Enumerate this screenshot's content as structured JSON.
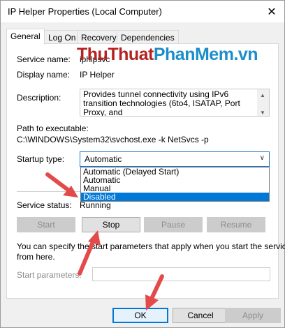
{
  "window": {
    "title": "IP Helper Properties (Local Computer)"
  },
  "icons": {
    "close": "close-icon"
  },
  "tabs": [
    {
      "label": "General"
    },
    {
      "label": "Log On"
    },
    {
      "label": "Recovery"
    },
    {
      "label": "Dependencies"
    }
  ],
  "general": {
    "service_name_label": "Service name:",
    "service_name_value": "iphlpsvc",
    "display_name_label": "Display name:",
    "display_name_value": "IP Helper",
    "description_label": "Description:",
    "description_value": "Provides tunnel connectivity using IPv6 transition technologies (6to4, ISATAP, Port Proxy, and",
    "path_label": "Path to executable:",
    "path_value": "C:\\WINDOWS\\System32\\svchost.exe -k NetSvcs -p",
    "startup_label": "Startup type:",
    "startup_value": "Automatic",
    "startup_options": [
      "Automatic (Delayed Start)",
      "Automatic",
      "Manual",
      "Disabled"
    ],
    "status_label": "Service status:",
    "status_value": "Running",
    "buttons": {
      "start": "Start",
      "stop": "Stop",
      "pause": "Pause",
      "resume": "Resume"
    },
    "help_text_1": "You can specify the start parameters that apply when you start the service",
    "help_text_2": "from here.",
    "params_label": "Start parameters:",
    "params_value": ""
  },
  "footer": {
    "ok": "OK",
    "cancel": "Cancel",
    "apply": "Apply"
  },
  "watermark": {
    "part1": "ThuThuat",
    "part2": "PhanMem",
    "part3": ".vn"
  },
  "colors": {
    "accent": "#0078d7",
    "arrow": "#e34b4b",
    "wm_red": "#b42222",
    "wm_blue": "#1c8ec9"
  }
}
